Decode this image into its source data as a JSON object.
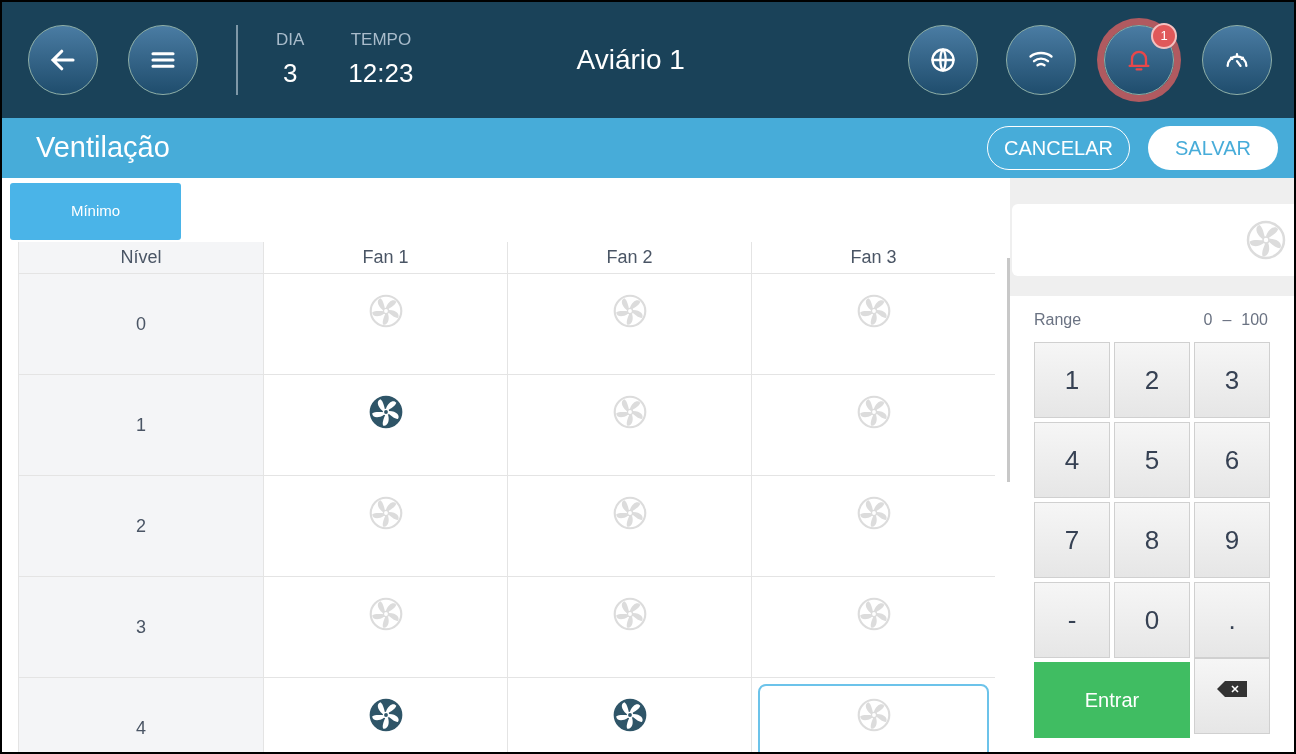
{
  "header": {
    "left_buttons": [
      {
        "kind": "back"
      },
      {
        "kind": "menu"
      }
    ],
    "day": {
      "label": "DIA",
      "value": "3"
    },
    "time": {
      "label": "TEMPO",
      "value": "12:23"
    },
    "title": "Aviário 1",
    "right_buttons": [
      {
        "kind": "globe",
        "alert": false
      },
      {
        "kind": "wifi",
        "alert": false
      },
      {
        "kind": "bell",
        "alert": true,
        "badge": "1"
      },
      {
        "kind": "gauge",
        "alert": false
      }
    ]
  },
  "page": {
    "title": "Ventilação",
    "buttons": [
      {
        "label": "CANCELAR",
        "kind": "outline"
      },
      {
        "label": "SALVAR",
        "kind": "solid"
      }
    ]
  },
  "tabs": [
    {
      "label": "Mínimo",
      "selected": true
    }
  ],
  "table": {
    "columns": [
      "Nível",
      "Fan 1",
      "Fan 2",
      "Fan 3"
    ],
    "rows": [
      {
        "level": "0",
        "fans": [
          {
            "on": false,
            "selected": false
          },
          {
            "on": false,
            "selected": false
          },
          {
            "on": false,
            "selected": false
          }
        ]
      },
      {
        "level": "1",
        "fans": [
          {
            "on": true,
            "selected": false
          },
          {
            "on": false,
            "selected": false
          },
          {
            "on": false,
            "selected": false
          }
        ]
      },
      {
        "level": "2",
        "fans": [
          {
            "on": false,
            "selected": false
          },
          {
            "on": false,
            "selected": false
          },
          {
            "on": false,
            "selected": false
          }
        ]
      },
      {
        "level": "3",
        "fans": [
          {
            "on": false,
            "selected": false
          },
          {
            "on": false,
            "selected": false
          },
          {
            "on": false,
            "selected": false
          }
        ]
      },
      {
        "level": "4",
        "fans": [
          {
            "on": true,
            "selected": false
          },
          {
            "on": true,
            "selected": false
          },
          {
            "on": false,
            "selected": true
          }
        ]
      }
    ]
  },
  "keypad": {
    "preview_fan_on": false,
    "range_label": "Range",
    "range_min": "0",
    "range_sep": "–",
    "range_max": "100",
    "keys": [
      {
        "kind": "key",
        "label": "1"
      },
      {
        "kind": "key",
        "label": "2"
      },
      {
        "kind": "key",
        "label": "3"
      },
      {
        "kind": "key",
        "label": "4"
      },
      {
        "kind": "key",
        "label": "5"
      },
      {
        "kind": "key",
        "label": "6"
      },
      {
        "kind": "key",
        "label": "7"
      },
      {
        "kind": "key",
        "label": "8"
      },
      {
        "kind": "key",
        "label": "9"
      },
      {
        "kind": "key",
        "label": "-"
      },
      {
        "kind": "key",
        "label": "0"
      },
      {
        "kind": "key",
        "label": "."
      },
      {
        "kind": "enter",
        "label": "Entrar"
      },
      {
        "kind": "backspace"
      }
    ]
  }
}
